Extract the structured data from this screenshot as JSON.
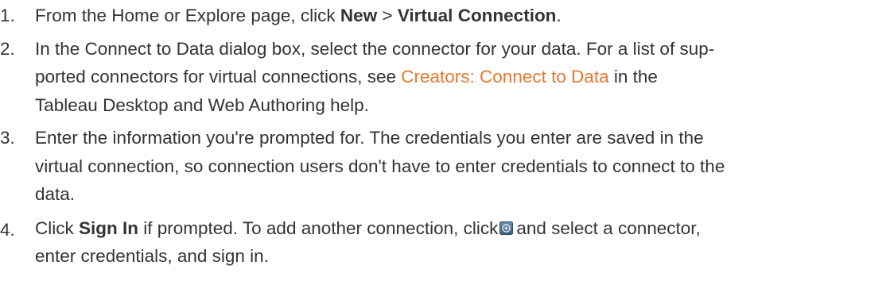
{
  "steps": [
    {
      "number": "1.",
      "t1": "From the Home or Explore page, click ",
      "b1": "New",
      "t2": " > ",
      "b2": "Virtual Connection",
      "t3": "."
    },
    {
      "number": "2.",
      "line1": "In the Connect to Data dialog box, select the connector for your data. For a list of sup-",
      "t1": "ported connectors for virtual connections, see ",
      "link": "Creators: Connect to Data",
      "t2": " in the",
      "line3": "Tableau Desktop and Web Authoring help."
    },
    {
      "number": "3.",
      "line1": "Enter the information you're prompted for. The credentials you enter are saved in the",
      "line2": "virtual connection, so connection users don't have to enter credentials to connect to the",
      "line3": "data."
    },
    {
      "number": "4.",
      "t1": "Click ",
      "b1": "Sign In",
      "t2": " if prompted. To add another connection, click",
      "icon": "add-connection-icon",
      "t3": "and select a connector,",
      "line2": "enter credentials, and sign in."
    }
  ],
  "colors": {
    "text": "#333333",
    "link": "#e8762d"
  }
}
